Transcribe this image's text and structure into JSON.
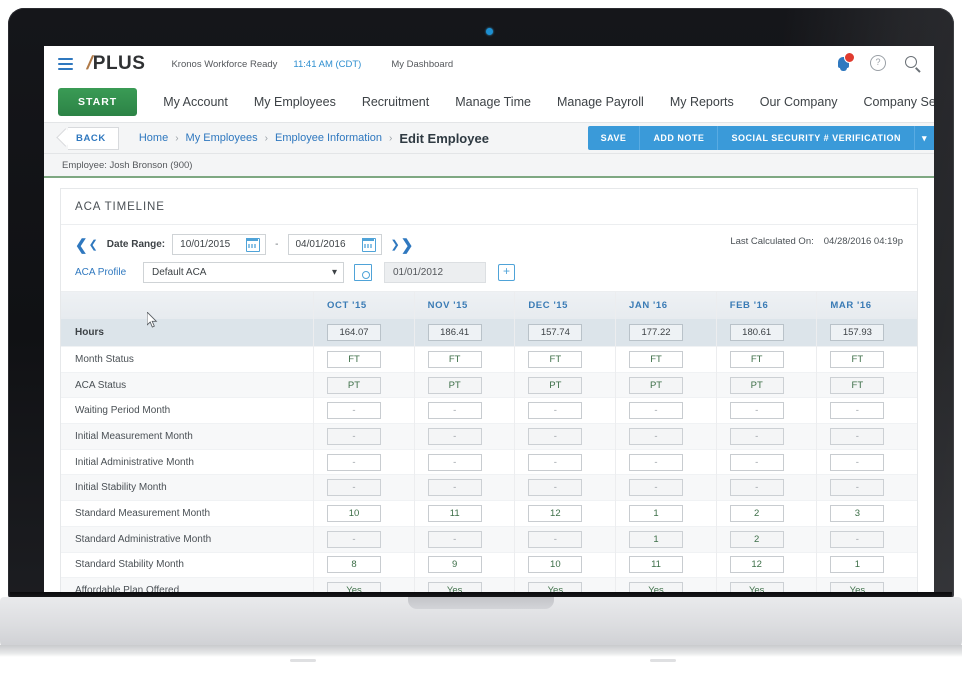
{
  "topbar": {
    "brand": "PLUS",
    "brand_slash": "/",
    "tenant": "Kronos Workforce Ready",
    "clock": "11:41 AM (CDT)",
    "dashboard": "My Dashboard",
    "icons": {
      "bell": "bell-icon",
      "help": "?",
      "search": "search-icon"
    }
  },
  "nav": {
    "start_label": "START",
    "items": [
      "My Account",
      "My Employees",
      "Recruitment",
      "Manage Time",
      "Manage Payroll",
      "My Reports",
      "Our Company",
      "Company Settings"
    ]
  },
  "breadcrumb": {
    "back_label": "BACK",
    "items": [
      "Home",
      "My Employees",
      "Employee Information"
    ],
    "separator": "›",
    "current": "Edit Employee"
  },
  "actions": {
    "save": "SAVE",
    "add_note": "ADD NOTE",
    "ssn_verification": "SOCIAL SECURITY # VERIFICATION",
    "caret": "▾"
  },
  "employee_bar": {
    "text": "Employee: Josh Bronson (900)"
  },
  "panel": {
    "title": "ACA TIMELINE",
    "filters": {
      "date_range_label": "Date Range:",
      "date_from": "10/01/2015",
      "date_to": "04/01/2016",
      "range_dash": "-",
      "aca_profile_label": "ACA Profile",
      "aca_profile_value": "Default ACA",
      "effective_date": "01/01/2012",
      "plus_label": "+",
      "last_calculated_label": "Last Calculated On:",
      "last_calculated_value": "04/28/2016 04:19p"
    }
  },
  "chart_data": {
    "type": "table",
    "title": "ACA TIMELINE",
    "categories": [
      "OCT '15",
      "NOV '15",
      "DEC '15",
      "JAN '16",
      "FEB '16",
      "MAR '16"
    ],
    "rows": [
      {
        "label": "Hours",
        "values": [
          "164.07",
          "186.41",
          "157.74",
          "177.22",
          "180.61",
          "157.93"
        ]
      },
      {
        "label": "Month Status",
        "values": [
          "FT",
          "FT",
          "FT",
          "FT",
          "FT",
          "FT"
        ]
      },
      {
        "label": "ACA Status",
        "values": [
          "PT",
          "PT",
          "PT",
          "PT",
          "PT",
          "FT"
        ]
      },
      {
        "label": "Waiting Period Month",
        "values": [
          "-",
          "-",
          "-",
          "-",
          "-",
          "-"
        ]
      },
      {
        "label": "Initial Measurement Month",
        "values": [
          "-",
          "-",
          "-",
          "-",
          "-",
          "-"
        ]
      },
      {
        "label": "Initial Administrative Month",
        "values": [
          "-",
          "-",
          "-",
          "-",
          "-",
          "-"
        ]
      },
      {
        "label": "Initial Stability Month",
        "values": [
          "-",
          "-",
          "-",
          "-",
          "-",
          "-"
        ]
      },
      {
        "label": "Standard Measurement Month",
        "values": [
          "10",
          "11",
          "12",
          "1",
          "2",
          "3"
        ]
      },
      {
        "label": "Standard Administrative Month",
        "values": [
          "-",
          "-",
          "-",
          "1",
          "2",
          "-"
        ]
      },
      {
        "label": "Standard Stability Month",
        "values": [
          "8",
          "9",
          "10",
          "11",
          "12",
          "1"
        ]
      },
      {
        "label": "Affordable Plan Offered",
        "values": [
          "Yes",
          "Yes",
          "Yes",
          "Yes",
          "Yes",
          "Yes"
        ]
      }
    ]
  },
  "colors": {
    "accent_blue": "#2f78bf",
    "action_blue": "#3a9ad9",
    "start_green": "#2c8346",
    "value_green": "#3c6e47",
    "badge_red": "#e03b2f"
  }
}
